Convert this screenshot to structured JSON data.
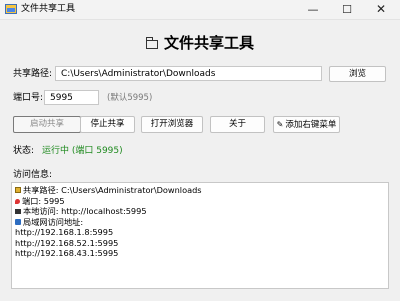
{
  "window": {
    "title": "文件共享工具",
    "controls": {
      "minimize": "—",
      "maximize": "☐",
      "close": "✕"
    }
  },
  "heading": "文件共享工具",
  "path": {
    "label": "共享路径:",
    "value": "C:\\Users\\Administrator\\Downloads",
    "browse_label": "浏览"
  },
  "port": {
    "label": "端口号:",
    "value": "5995",
    "hint": "(默认5995)"
  },
  "actions": {
    "start": "启动共享",
    "stop": "停止共享",
    "open_browser": "打开浏览器",
    "about": "关于",
    "context_menu": "添加右键菜单"
  },
  "status": {
    "label": "状态:",
    "value": "运行中 (端口 5995)"
  },
  "info": {
    "label": "访问信息:",
    "lines": [
      {
        "icon": "folder-icon",
        "text": "共享路径: C:\\Users\\Administrator\\Downloads"
      },
      {
        "icon": "pin-icon",
        "text": "端口: 5995"
      },
      {
        "icon": "computer-icon",
        "text": "本地访问: http://localhost:5995"
      },
      {
        "icon": "network-icon",
        "text": "局域网访问地址:"
      },
      {
        "icon": "",
        "text": "http://192.168.1.8:5995"
      },
      {
        "icon": "",
        "text": "http://192.168.52.1:5995"
      },
      {
        "icon": "",
        "text": "http://192.168.43.1:5995"
      }
    ]
  },
  "colors": {
    "status_running": "#1f8a1f",
    "hint": "#7a7a7a",
    "background": "#f0f0f0"
  }
}
